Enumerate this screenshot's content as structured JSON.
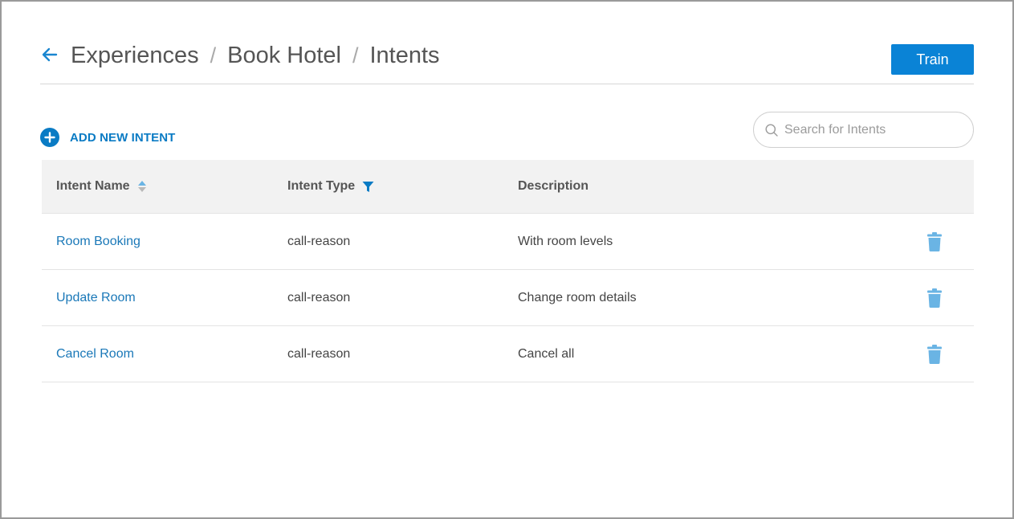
{
  "breadcrumb": {
    "items": [
      "Experiences",
      "Book Hotel",
      "Intents"
    ],
    "separator": "/"
  },
  "actions": {
    "train_label": "Train",
    "add_intent_label": "ADD NEW INTENT"
  },
  "search": {
    "placeholder": "Search for Intents",
    "value": ""
  },
  "table": {
    "columns": [
      "Intent Name",
      "Intent Type",
      "Description"
    ],
    "rows": [
      {
        "name": "Room Booking",
        "type": "call-reason",
        "description": "With room levels"
      },
      {
        "name": "Update Room",
        "type": "call-reason",
        "description": "Change room details"
      },
      {
        "name": "Cancel Room",
        "type": "call-reason",
        "description": "Cancel all"
      }
    ]
  },
  "icons": {
    "back": "arrow-left-icon",
    "add": "plus-circle-icon",
    "search": "search-icon",
    "sort": "sort-icon",
    "filter": "filter-icon",
    "delete": "trash-icon"
  },
  "colors": {
    "accent": "#0a83d6",
    "link": "#1a78b8",
    "delete_icon": "#6ab4e4",
    "header_bg": "#f2f2f2"
  }
}
